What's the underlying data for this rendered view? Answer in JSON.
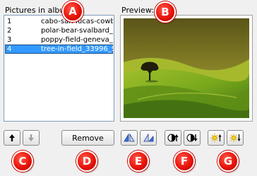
{
  "labels": {
    "pictures_in_album": "Pictures in album:",
    "preview": "Preview:"
  },
  "album_list": [
    {
      "num": "1",
      "name": "cabo-san-lucas-cowbo",
      "selected": false
    },
    {
      "num": "2",
      "name": "polar-bear-svalbard_",
      "selected": false
    },
    {
      "num": "3",
      "name": "poppy-field-geneva_",
      "selected": false
    },
    {
      "num": "4",
      "name": "tree-in-field_33996_9",
      "selected": true
    }
  ],
  "buttons": {
    "remove_label": "Remove"
  },
  "callouts": {
    "a": "A",
    "b": "B",
    "c": "C",
    "d": "D",
    "e": "E",
    "f": "F",
    "g": "G"
  },
  "icons": {
    "move_up": "arrow-up-icon",
    "move_down": "arrow-down-icon",
    "flip_horizontal": "flip-horizontal-icon",
    "flip_vertical": "flip-vertical-icon",
    "contrast_up": "contrast-up-icon",
    "contrast_down": "contrast-down-icon",
    "brightness_up": "brightness-up-icon",
    "brightness_down": "brightness-down-icon"
  },
  "colors": {
    "callout": "#e8140a",
    "selection": "#3399ff",
    "list_border": "#7f9db9"
  }
}
